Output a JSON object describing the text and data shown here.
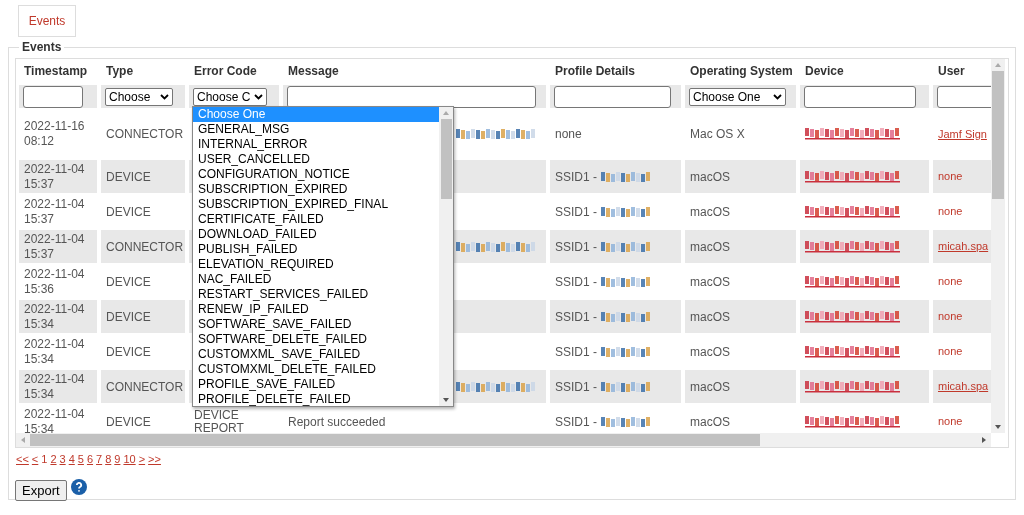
{
  "tab": {
    "label": "Events",
    "selected": true
  },
  "section": {
    "title": "Events"
  },
  "table": {
    "columns": [
      {
        "label": "Timestamp",
        "filter": {
          "kind": "text"
        }
      },
      {
        "label": "Type",
        "filter": {
          "kind": "select",
          "value": "Choose"
        }
      },
      {
        "label": "Error Code",
        "filter": {
          "kind": "select",
          "value": "Choose C"
        }
      },
      {
        "label": "Message",
        "filter": {
          "kind": "text"
        }
      },
      {
        "label": "Profile Details",
        "filter": {
          "kind": "text"
        }
      },
      {
        "label": "Operating System",
        "filter": {
          "kind": "select",
          "value": "Choose One"
        }
      },
      {
        "label": "Device",
        "filter": {
          "kind": "text"
        }
      },
      {
        "label": "User",
        "filter": {
          "kind": "text"
        }
      }
    ],
    "rows": [
      {
        "timestamp": [
          "2022-11-16",
          "08:12"
        ],
        "type": "CONNECTOR",
        "message_redacted": true,
        "profile": "none",
        "profile_redacted": false,
        "os": "Mac OS X",
        "user": {
          "text": "Jamf Sign",
          "link": true
        }
      },
      {
        "timestamp": [
          "2022-11-04",
          "15:37"
        ],
        "type": "DEVICE",
        "message_redacted": false,
        "profile": "SSID1 -",
        "profile_redacted": true,
        "os": "macOS",
        "user": {
          "text": "none",
          "link": false
        }
      },
      {
        "timestamp": [
          "2022-11-04",
          "15:37"
        ],
        "type": "DEVICE",
        "message_redacted": false,
        "profile": "SSID1 -",
        "profile_redacted": true,
        "os": "macOS",
        "user": {
          "text": "none",
          "link": false
        }
      },
      {
        "timestamp": [
          "2022-11-04",
          "15:37"
        ],
        "type": "CONNECTOR",
        "message_redacted": true,
        "profile": "SSID1 -",
        "profile_redacted": true,
        "os": "macOS",
        "user": {
          "text": "micah.spa",
          "link": true
        }
      },
      {
        "timestamp": [
          "2022-11-04",
          "15:36"
        ],
        "type": "DEVICE",
        "message_redacted": false,
        "profile": "SSID1 -",
        "profile_redacted": true,
        "os": "macOS",
        "user": {
          "text": "none",
          "link": false
        }
      },
      {
        "timestamp": [
          "2022-11-04",
          "15:34"
        ],
        "type": "DEVICE",
        "message_redacted": false,
        "profile": "SSID1 -",
        "profile_redacted": true,
        "os": "macOS",
        "user": {
          "text": "none",
          "link": false
        }
      },
      {
        "timestamp": [
          "2022-11-04",
          "15:34"
        ],
        "type": "DEVICE",
        "message_redacted": false,
        "profile": "SSID1 -",
        "profile_redacted": true,
        "os": "macOS",
        "user": {
          "text": "none",
          "link": false
        }
      },
      {
        "timestamp": [
          "2022-11-04",
          "15:34"
        ],
        "type": "CONNECTOR",
        "message_redacted": true,
        "profile": "SSID1 -",
        "profile_redacted": true,
        "os": "macOS",
        "user": {
          "text": "micah.spa",
          "link": true
        }
      },
      {
        "timestamp": [
          "2022-11-04",
          "15:34"
        ],
        "type": "DEVICE",
        "error_code": [
          "DEVICE",
          "REPORT"
        ],
        "message": "Report succeeded",
        "message_redacted": false,
        "profile": "SSID1 -",
        "profile_redacted": true,
        "os": "macOS",
        "user": {
          "text": "none",
          "link": false
        }
      }
    ]
  },
  "dropdown": {
    "options": [
      {
        "label": "Choose One",
        "selected": true
      },
      {
        "label": "GENERAL_MSG",
        "selected": false
      },
      {
        "label": "INTERNAL_ERROR",
        "selected": false
      },
      {
        "label": "USER_CANCELLED",
        "selected": false
      },
      {
        "label": "CONFIGURATION_NOTICE",
        "selected": false
      },
      {
        "label": "SUBSCRIPTION_EXPIRED",
        "selected": false
      },
      {
        "label": "SUBSCRIPTION_EXPIRED_FINAL",
        "selected": false
      },
      {
        "label": "CERTIFICATE_FAILED",
        "selected": false
      },
      {
        "label": "DOWNLOAD_FAILED",
        "selected": false
      },
      {
        "label": "PUBLISH_FAILED",
        "selected": false
      },
      {
        "label": "ELEVATION_REQUIRED",
        "selected": false
      },
      {
        "label": "NAC_FAILED",
        "selected": false
      },
      {
        "label": "RESTART_SERVICES_FAILED",
        "selected": false
      },
      {
        "label": "RENEW_IP_FAILED",
        "selected": false
      },
      {
        "label": "SOFTWARE_SAVE_FAILED",
        "selected": false
      },
      {
        "label": "SOFTWARE_DELETE_FAILED",
        "selected": false
      },
      {
        "label": "CUSTOMXML_SAVE_FAILED",
        "selected": false
      },
      {
        "label": "CUSTOMXML_DELETE_FAILED",
        "selected": false
      },
      {
        "label": "PROFILE_SAVE_FAILED",
        "selected": false
      },
      {
        "label": "PROFILE_DELETE_FAILED",
        "selected": false
      }
    ]
  },
  "pagination": [
    {
      "label": "<<",
      "selected": false
    },
    {
      "label": "<",
      "selected": false
    },
    {
      "label": "1",
      "selected": true
    },
    {
      "label": "2",
      "selected": false
    },
    {
      "label": "3",
      "selected": false
    },
    {
      "label": "4",
      "selected": false
    },
    {
      "label": "5",
      "selected": false
    },
    {
      "label": "6",
      "selected": false
    },
    {
      "label": "7",
      "selected": false
    },
    {
      "label": "8",
      "selected": false
    },
    {
      "label": "9",
      "selected": false
    },
    {
      "label": "10",
      "selected": false
    },
    {
      "label": ">",
      "selected": false
    },
    {
      "label": ">>",
      "selected": false
    }
  ],
  "export_button": "Export"
}
